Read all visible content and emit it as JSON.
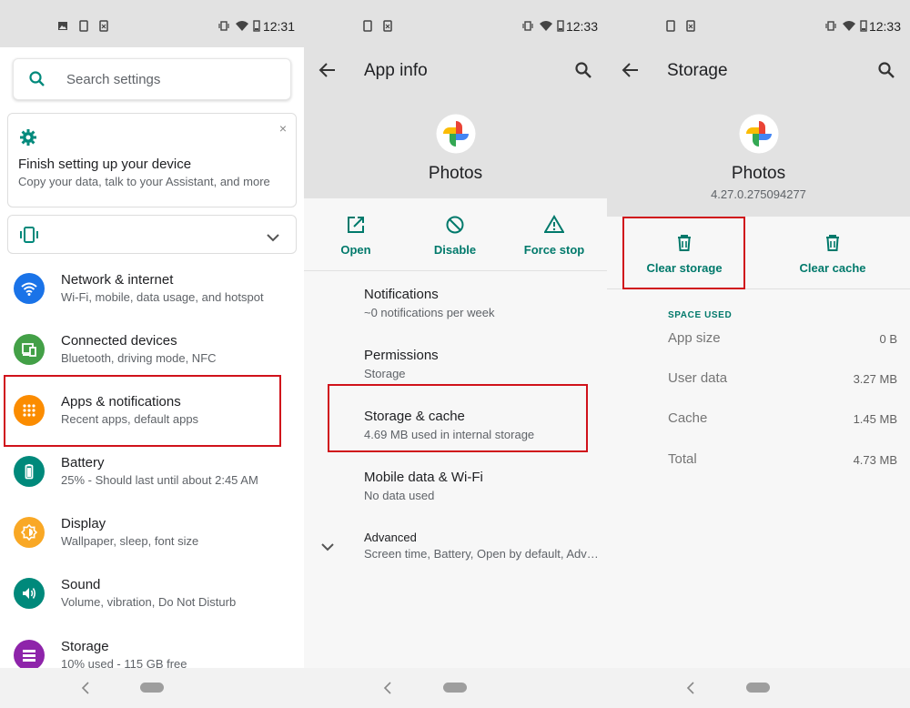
{
  "status_bar": {
    "s1_time": "12:31",
    "s2_time": "12:33",
    "s3_time": "12:33"
  },
  "settings": {
    "search_placeholder": "Search settings",
    "setup_card": {
      "title": "Finish setting up your device",
      "subtitle": "Copy your data, talk to your Assistant, and more",
      "close": "×"
    },
    "items": [
      {
        "title": "Network & internet",
        "subtitle": "Wi-Fi, mobile, data usage, and hotspot",
        "icon": "wifi-icon",
        "color": "#1a73e8"
      },
      {
        "title": "Connected devices",
        "subtitle": "Bluetooth, driving mode, NFC",
        "icon": "devices-icon",
        "color": "#43a047"
      },
      {
        "title": "Apps & notifications",
        "subtitle": "Recent apps, default apps",
        "icon": "apps-icon",
        "color": "#fb8c00"
      },
      {
        "title": "Battery",
        "subtitle": "25% - Should last until about 2:45 AM",
        "icon": "battery-icon",
        "color": "#00897b"
      },
      {
        "title": "Display",
        "subtitle": "Wallpaper, sleep, font size",
        "icon": "brightness-icon",
        "color": "#f9a825"
      },
      {
        "title": "Sound",
        "subtitle": "Volume, vibration, Do Not Disturb",
        "icon": "volume-icon",
        "color": "#00897b"
      },
      {
        "title": "Storage",
        "subtitle": "10% used - 115 GB free",
        "icon": "storage-icon",
        "color": "#8e24aa"
      }
    ]
  },
  "app_info": {
    "title": "App info",
    "app_name": "Photos",
    "actions": [
      {
        "label": "Open",
        "icon": "open-external-icon"
      },
      {
        "label": "Disable",
        "icon": "disable-icon"
      },
      {
        "label": "Force stop",
        "icon": "warning-icon"
      }
    ],
    "items": [
      {
        "title": "Notifications",
        "subtitle": "~0 notifications per week"
      },
      {
        "title": "Permissions",
        "subtitle": "Storage"
      },
      {
        "title": "Storage & cache",
        "subtitle": "4.69 MB used in internal storage"
      },
      {
        "title": "Mobile data & Wi-Fi",
        "subtitle": "No data used"
      },
      {
        "title": "Advanced",
        "subtitle": "Screen time, Battery, Open by default, Adva..."
      }
    ]
  },
  "storage": {
    "title": "Storage",
    "app_name": "Photos",
    "version": "4.27.0.275094277",
    "clear_storage": "Clear storage",
    "clear_cache": "Clear cache",
    "section": "SPACE USED",
    "rows": [
      {
        "label": "App size",
        "value": "0 B"
      },
      {
        "label": "User data",
        "value": "3.27 MB"
      },
      {
        "label": "Cache",
        "value": "1.45 MB"
      },
      {
        "label": "Total",
        "value": "4.73 MB"
      }
    ]
  },
  "colors": {
    "accent": "#00796b",
    "highlight": "#d0121b"
  }
}
